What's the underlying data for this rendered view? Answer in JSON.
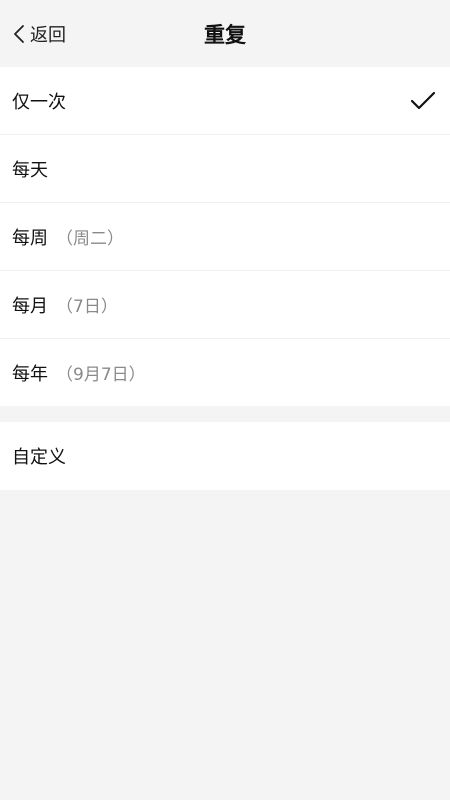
{
  "header": {
    "back_label": "返回",
    "title": "重复"
  },
  "options": [
    {
      "label": "仅一次",
      "hint": "",
      "selected": true
    },
    {
      "label": "每天",
      "hint": "",
      "selected": false
    },
    {
      "label": "每周",
      "hint": "（周二）",
      "selected": false
    },
    {
      "label": "每月",
      "hint": "（7日）",
      "selected": false
    },
    {
      "label": "每年",
      "hint": "（9月7日）",
      "selected": false
    }
  ],
  "custom": {
    "label": "自定义"
  },
  "icons": {
    "back": "chevron-left-icon",
    "check": "checkmark-icon"
  },
  "colors": {
    "background": "#f4f4f4",
    "card": "#ffffff",
    "hint": "#8a8a8a"
  }
}
